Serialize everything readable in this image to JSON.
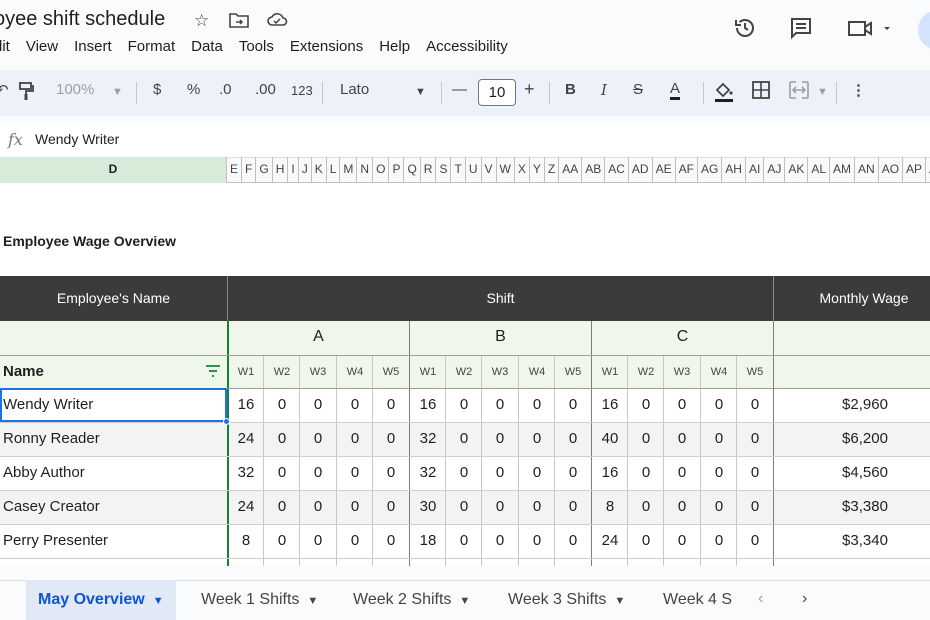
{
  "title": {
    "doc_title": "oyee shift schedule",
    "star_icon": "star-icon",
    "move_icon": "folder-move-icon",
    "cloud_icon": "cloud-status-icon"
  },
  "menu": [
    "dit",
    "View",
    "Insert",
    "Format",
    "Data",
    "Tools",
    "Extensions",
    "Help",
    "Accessibility"
  ],
  "toolbar": {
    "zoom": "100%",
    "currency": "$",
    "percent": "%",
    "dec_decrease": ".0",
    "dec_increase": ".00",
    "format_123": "123",
    "font": "Lato",
    "font_size": "10",
    "minus": "—",
    "plus": "+",
    "bold": "B",
    "italic": "I",
    "text_color_letter": "A"
  },
  "formula_bar": {
    "fx": "fx",
    "value": "Wendy Writer"
  },
  "columns": {
    "selected": "D",
    "others": [
      "E",
      "F",
      "G",
      "H",
      "I",
      "J",
      "K",
      "L",
      "M",
      "N",
      "O",
      "P",
      "Q",
      "R",
      "S",
      "T",
      "U",
      "V",
      "W",
      "X",
      "Y",
      "Z",
      "AA",
      "AB",
      "AC",
      "AD",
      "AE",
      "AF",
      "AG",
      "AH",
      "AI",
      "AJ",
      "AK",
      "AL",
      "AM",
      "AN",
      "AO",
      "AP",
      "AQ"
    ]
  },
  "sheet": {
    "overview_title": "Employee Wage Overview",
    "header_name": "Employee's Name",
    "header_shift": "Shift",
    "header_wage": "Monthly Wage",
    "groups": [
      "A",
      "B",
      "C"
    ],
    "weeks": [
      "W1",
      "W2",
      "W3",
      "W4",
      "W5"
    ],
    "name_col_label": "Name",
    "rows": [
      {
        "name": "Wendy Writer",
        "a": [
          "16",
          "0",
          "0",
          "0",
          "0"
        ],
        "b": [
          "16",
          "0",
          "0",
          "0",
          "0"
        ],
        "c": [
          "16",
          "0",
          "0",
          "0",
          "0"
        ],
        "wage": "$2,960"
      },
      {
        "name": "Ronny Reader",
        "a": [
          "24",
          "0",
          "0",
          "0",
          "0"
        ],
        "b": [
          "32",
          "0",
          "0",
          "0",
          "0"
        ],
        "c": [
          "40",
          "0",
          "0",
          "0",
          "0"
        ],
        "wage": "$6,200"
      },
      {
        "name": "Abby Author",
        "a": [
          "32",
          "0",
          "0",
          "0",
          "0"
        ],
        "b": [
          "32",
          "0",
          "0",
          "0",
          "0"
        ],
        "c": [
          "16",
          "0",
          "0",
          "0",
          "0"
        ],
        "wage": "$4,560"
      },
      {
        "name": "Casey Creator",
        "a": [
          "24",
          "0",
          "0",
          "0",
          "0"
        ],
        "b": [
          "30",
          "0",
          "0",
          "0",
          "0"
        ],
        "c": [
          "8",
          "0",
          "0",
          "0",
          "0"
        ],
        "wage": "$3,380"
      },
      {
        "name": "Perry Presenter",
        "a": [
          "8",
          "0",
          "0",
          "0",
          "0"
        ],
        "b": [
          "18",
          "0",
          "0",
          "0",
          "0"
        ],
        "c": [
          "24",
          "0",
          "0",
          "0",
          "0"
        ],
        "wage": "$3,340"
      }
    ]
  },
  "tabs": [
    {
      "label": "May Overview",
      "active": true
    },
    {
      "label": "Week 1 Shifts",
      "active": false
    },
    {
      "label": "Week 2 Shifts",
      "active": false
    },
    {
      "label": "Week 3 Shifts",
      "active": false
    },
    {
      "label": "Week 4 S",
      "active": false
    }
  ],
  "colors": {
    "accent": "#0b57d0",
    "header_dark": "#3b3b3b",
    "group_green": "#eef7ea",
    "selection": "#1a73e8"
  }
}
